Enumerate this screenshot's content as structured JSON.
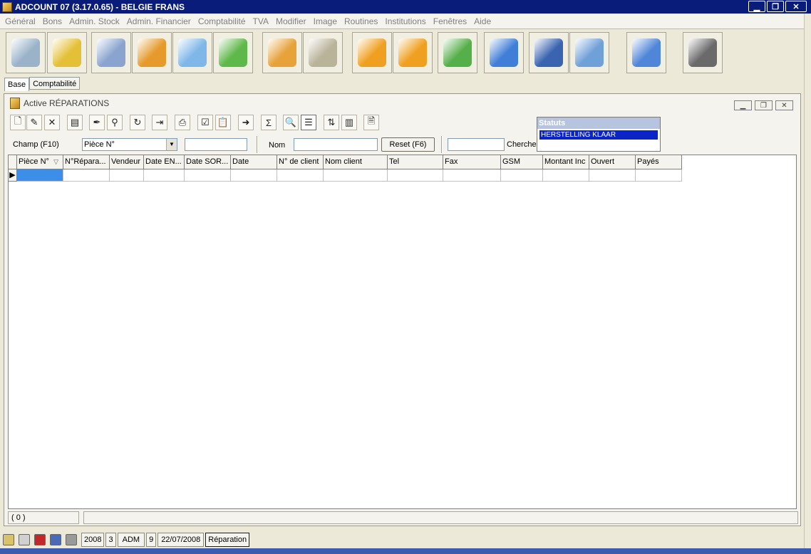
{
  "window": {
    "title": "ADCOUNT 07 (3.17.0.65)  - BELGIE FRANS",
    "min": "▁",
    "max": "❐",
    "close": "✕"
  },
  "menu": [
    "Général",
    "Bons",
    "Admin. Stock",
    "Admin. Financier",
    "Comptabilité",
    "TVA",
    "Modifier",
    "Image",
    "Routines",
    "Institutions",
    "Fenêtres",
    "Aide"
  ],
  "big_toolbar": [
    {
      "name": "cart-icon",
      "color": "#9bb3c9"
    },
    {
      "name": "coins-icon",
      "color": "#e4c038"
    },
    {
      "name": "settings-gear-icon",
      "color": "#8aa4cf"
    },
    {
      "name": "computer-gear-icon",
      "color": "#e59a2b"
    },
    {
      "name": "computer-bulb-icon",
      "color": "#7fb8e8"
    },
    {
      "name": "green-book-icon",
      "color": "#5fb84a"
    },
    {
      "name": "orange-binder-icon",
      "color": "#e7a23a"
    },
    {
      "name": "keys-icon",
      "color": "#b9b39a"
    },
    {
      "name": "download-arrow-icon",
      "color": "#f0a020"
    },
    {
      "name": "upload-arrow-icon",
      "color": "#f0a020"
    },
    {
      "name": "green-download-icon",
      "color": "#56b049"
    },
    {
      "name": "window-download-icon",
      "color": "#3f7fd8"
    },
    {
      "name": "user-icon",
      "color": "#3a64b0"
    },
    {
      "name": "truck-icon",
      "color": "#6fa0d8"
    },
    {
      "name": "lightbulb-icon",
      "color": "#4f86d8"
    },
    {
      "name": "speaker-icon",
      "color": "#6a6a6a"
    }
  ],
  "tabs": [
    "Base",
    "Comptabilité"
  ],
  "child": {
    "title": "Active RÉPARATIONS"
  },
  "small_toolbar": [
    {
      "name": "new-document-icon",
      "glyph": "🗋"
    },
    {
      "name": "edit-document-icon",
      "glyph": "✎"
    },
    {
      "name": "delete-icon",
      "glyph": "✕"
    },
    {
      "name": "properties-icon",
      "glyph": "▤"
    },
    {
      "name": "pen-tool-icon",
      "glyph": "✒"
    },
    {
      "name": "binoculars-icon",
      "glyph": "⚲"
    },
    {
      "name": "refresh-icon",
      "glyph": "↻"
    },
    {
      "name": "find-next-icon",
      "glyph": "⇥"
    },
    {
      "name": "print-icon",
      "glyph": "⎙"
    },
    {
      "name": "checklist-icon",
      "glyph": "☑"
    },
    {
      "name": "clipboard-icon",
      "glyph": "📋"
    },
    {
      "name": "export-icon",
      "glyph": "➜"
    },
    {
      "name": "sum-icon",
      "glyph": "Σ"
    },
    {
      "name": "zoom-icon",
      "glyph": "🔍"
    },
    {
      "name": "list-view-icon",
      "glyph": "☰"
    },
    {
      "name": "sort-az-icon",
      "glyph": "⇅"
    },
    {
      "name": "columns-icon",
      "glyph": "▥"
    },
    {
      "name": "page-icon",
      "glyph": "🗎"
    }
  ],
  "filter": {
    "champ_label": "Champ (F10)",
    "champ_value": "Pièce N°",
    "nom_label": "Nom",
    "reset_label": "Reset (F6)",
    "chercher_label": "Chercher"
  },
  "statuts": {
    "title": "Statuts",
    "selected": "HERSTELLING KLAAR"
  },
  "grid": {
    "columns": [
      "Pièce N°",
      "N°Répara...",
      "Vendeur",
      "Date EN...",
      "Date SOR...",
      "Date",
      "N° de client",
      "Nom client",
      "Tel",
      "Fax",
      "GSM",
      "Montant Inc",
      "Ouvert",
      "Payés"
    ],
    "row_indicator": "▶"
  },
  "child_status": {
    "count": "( 0 )"
  },
  "status_bar": {
    "icons": [
      {
        "name": "notes-icon",
        "color": "#d8c36a"
      },
      {
        "name": "pencil-icon",
        "color": "#8a8a8a"
      },
      {
        "name": "toolbox-icon",
        "color": "#c0282a"
      },
      {
        "name": "calendar-icon",
        "color": "#4a6ab8"
      },
      {
        "name": "calculator-icon",
        "color": "#9a9a9a"
      }
    ],
    "year": "2008",
    "period": "3",
    "user": "ADM",
    "num": "9",
    "date": "22/07/2008",
    "module": "Réparation"
  }
}
